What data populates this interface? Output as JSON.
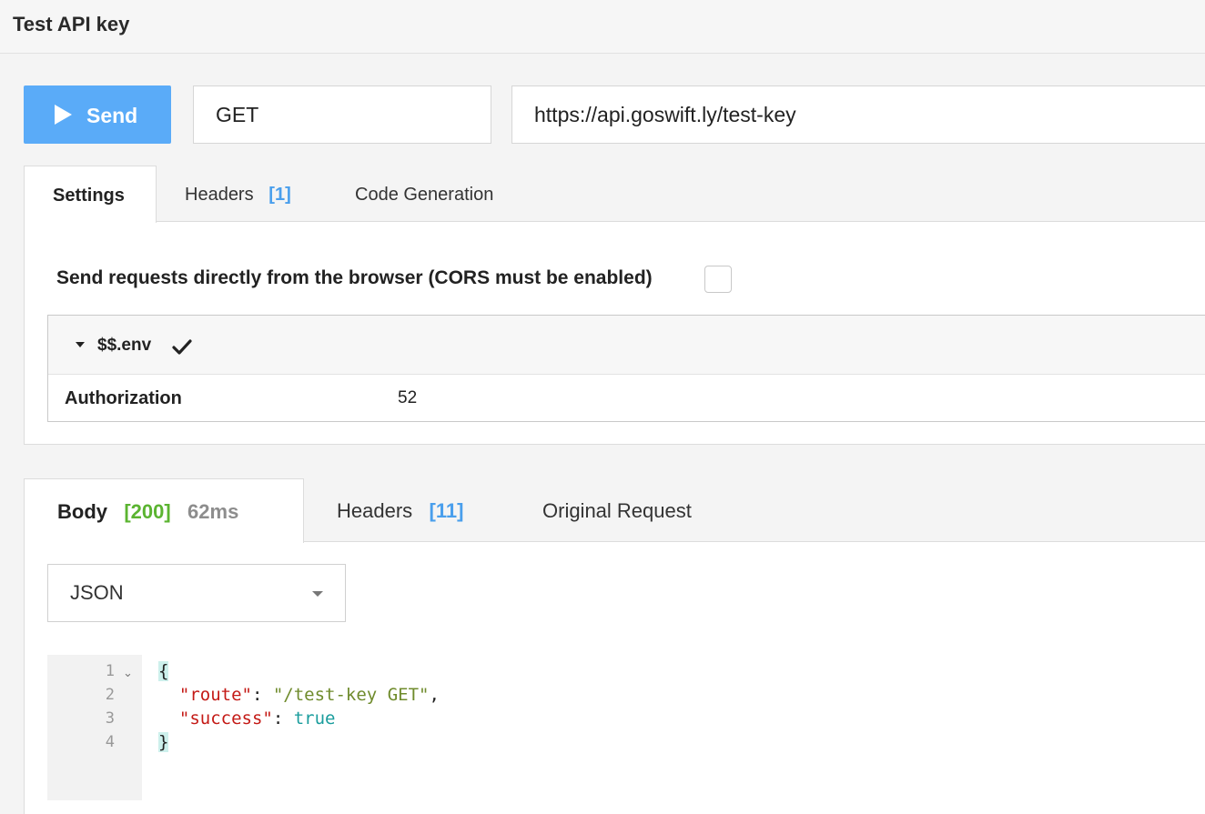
{
  "header": {
    "title": "Test API key"
  },
  "request": {
    "send_label": "Send",
    "method": "GET",
    "url": "https://api.goswift.ly/test-key"
  },
  "request_tabs": [
    {
      "label": "Settings",
      "active": true
    },
    {
      "label": "Headers",
      "count": "[1]"
    },
    {
      "label": "Code Generation"
    }
  ],
  "settings": {
    "cors_label": "Send requests directly from the browser (CORS must be enabled)",
    "cors_checked": false,
    "env": {
      "name": "$$.env",
      "key": "Authorization",
      "value": "52"
    }
  },
  "response_tabs": [
    {
      "label": "Body",
      "status": "[200]",
      "time": "62ms",
      "active": true
    },
    {
      "label": "Headers",
      "count": "[11]"
    },
    {
      "label": "Original Request"
    }
  ],
  "response": {
    "format": "JSON",
    "line_numbers": [
      "1",
      "2",
      "3",
      "4"
    ],
    "code": {
      "open": "{",
      "route_key": "\"route\"",
      "route_value": "\"/test-key GET\"",
      "success_key": "\"success\"",
      "success_value": "true",
      "close": "}"
    }
  }
}
